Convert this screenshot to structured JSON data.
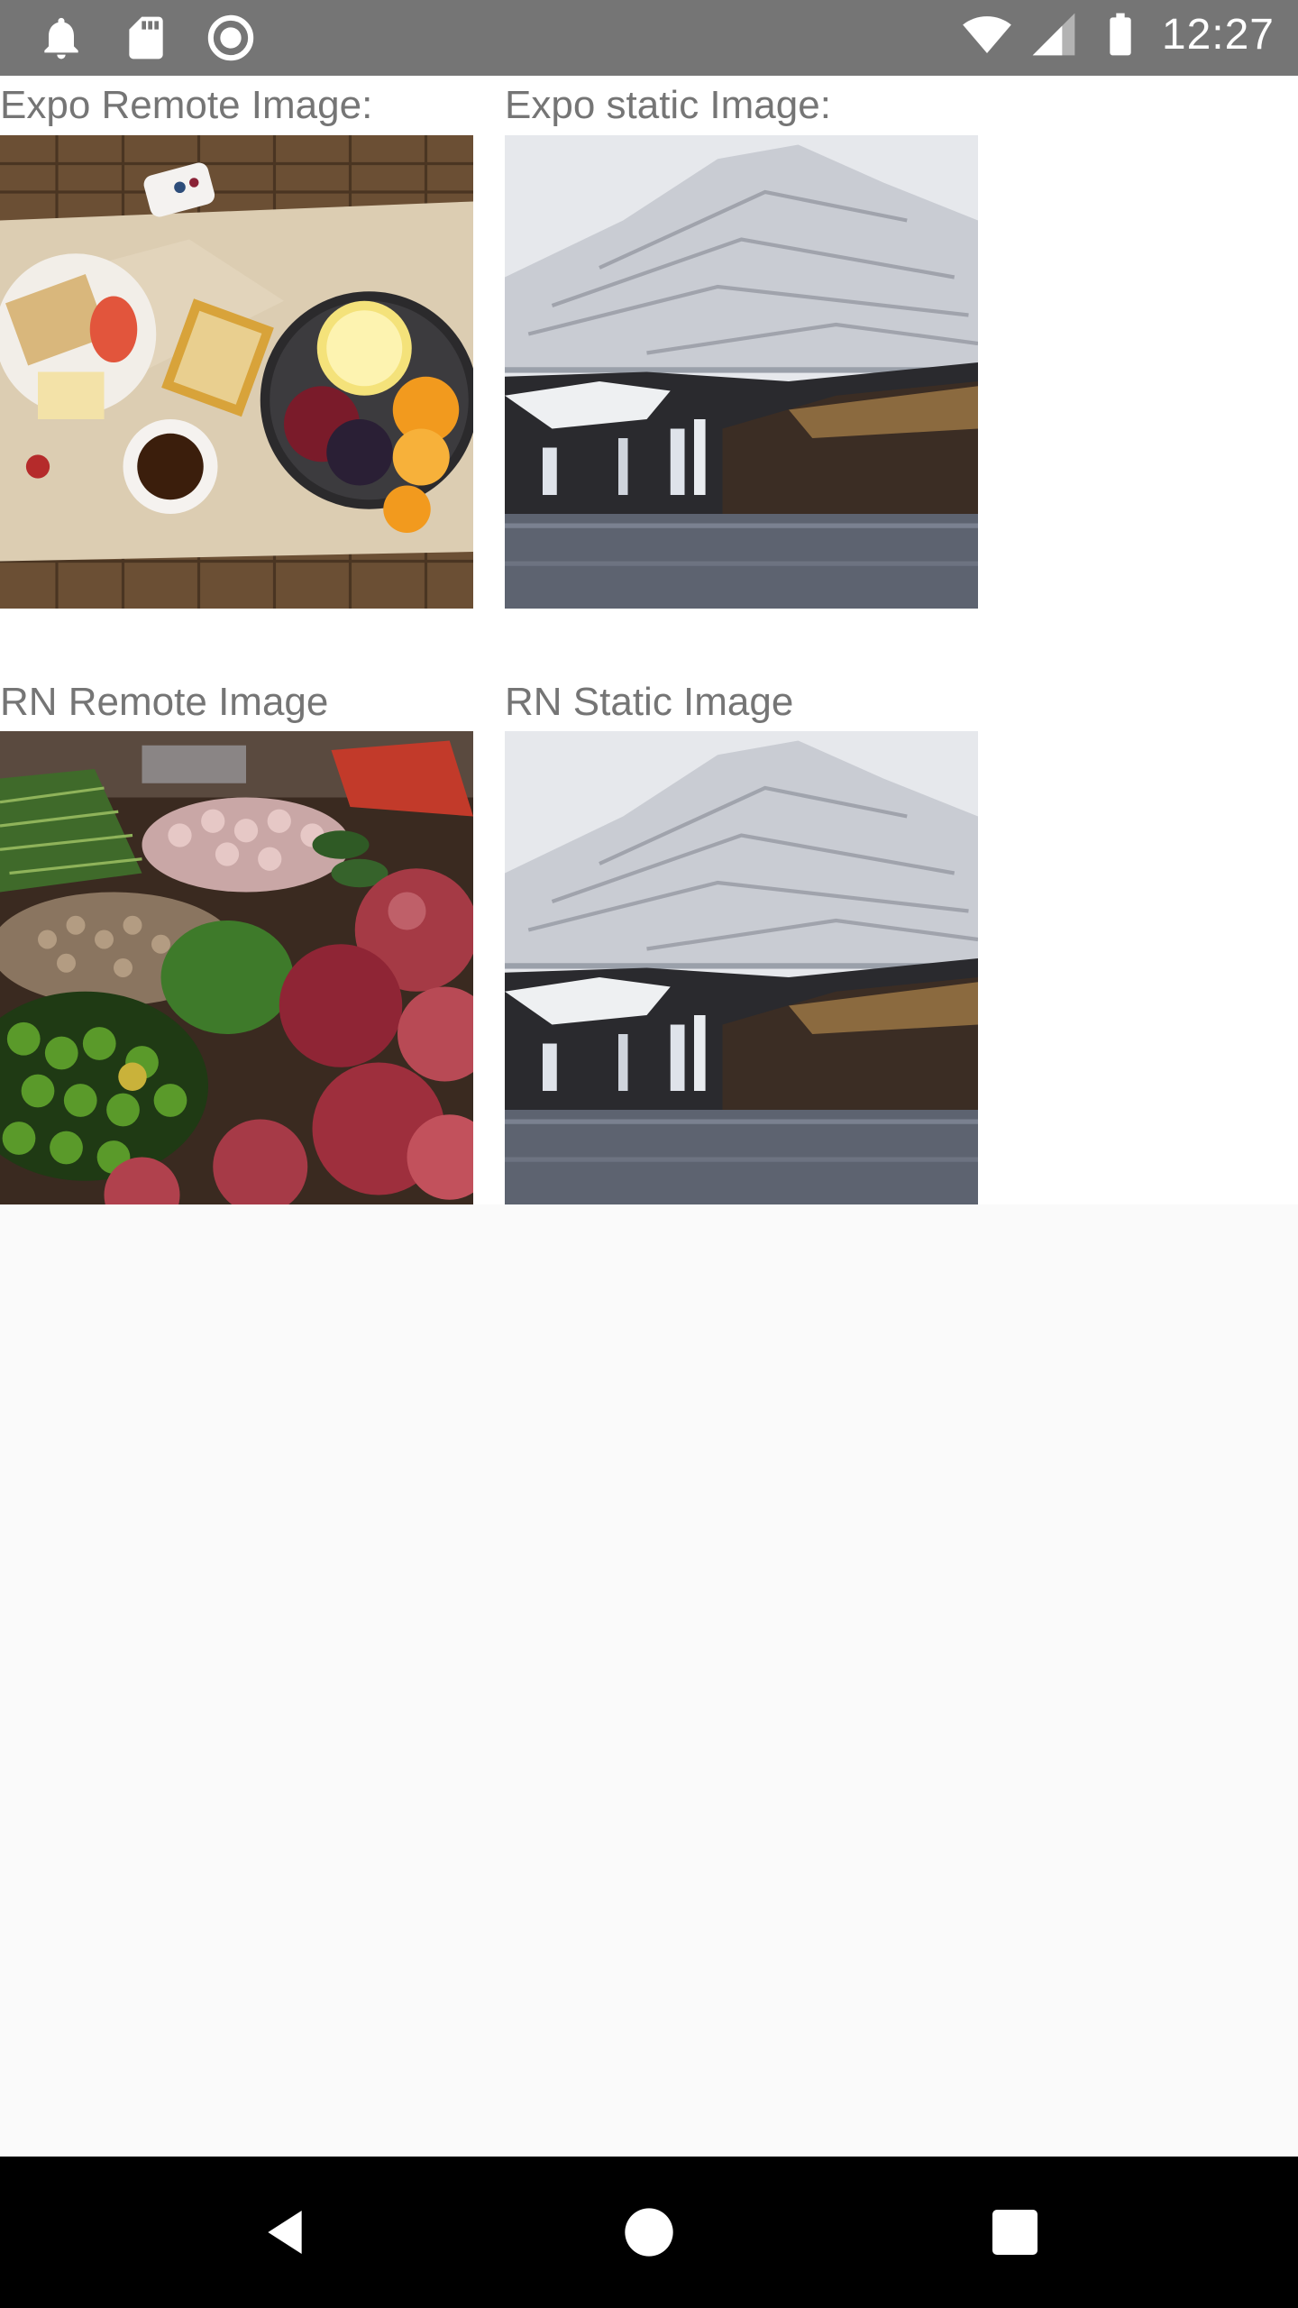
{
  "status_bar": {
    "time": "12:27",
    "left_icons": [
      "notification-bell-icon",
      "sd-card-icon",
      "sync-circle-icon"
    ],
    "right_icons": [
      "wifi-icon",
      "cell-signal-icon",
      "battery-icon"
    ]
  },
  "sections": [
    {
      "label": "Expo Remote Image:",
      "image": "breakfast-table-image"
    },
    {
      "label": "Expo static Image:",
      "image": "waterfall-mountain-image"
    },
    {
      "label": "RN Remote Image",
      "image": "market-produce-image"
    },
    {
      "label": "RN Static Image",
      "image": "waterfall-mountain-image"
    }
  ],
  "nav_bar": {
    "buttons": [
      "back-icon",
      "home-icon",
      "recents-icon"
    ]
  },
  "colors": {
    "status_bar": "#757575",
    "nav_bar": "#000000",
    "content_bg": "#ffffff",
    "page_bg": "#fafafa",
    "label_text": "#757575"
  }
}
